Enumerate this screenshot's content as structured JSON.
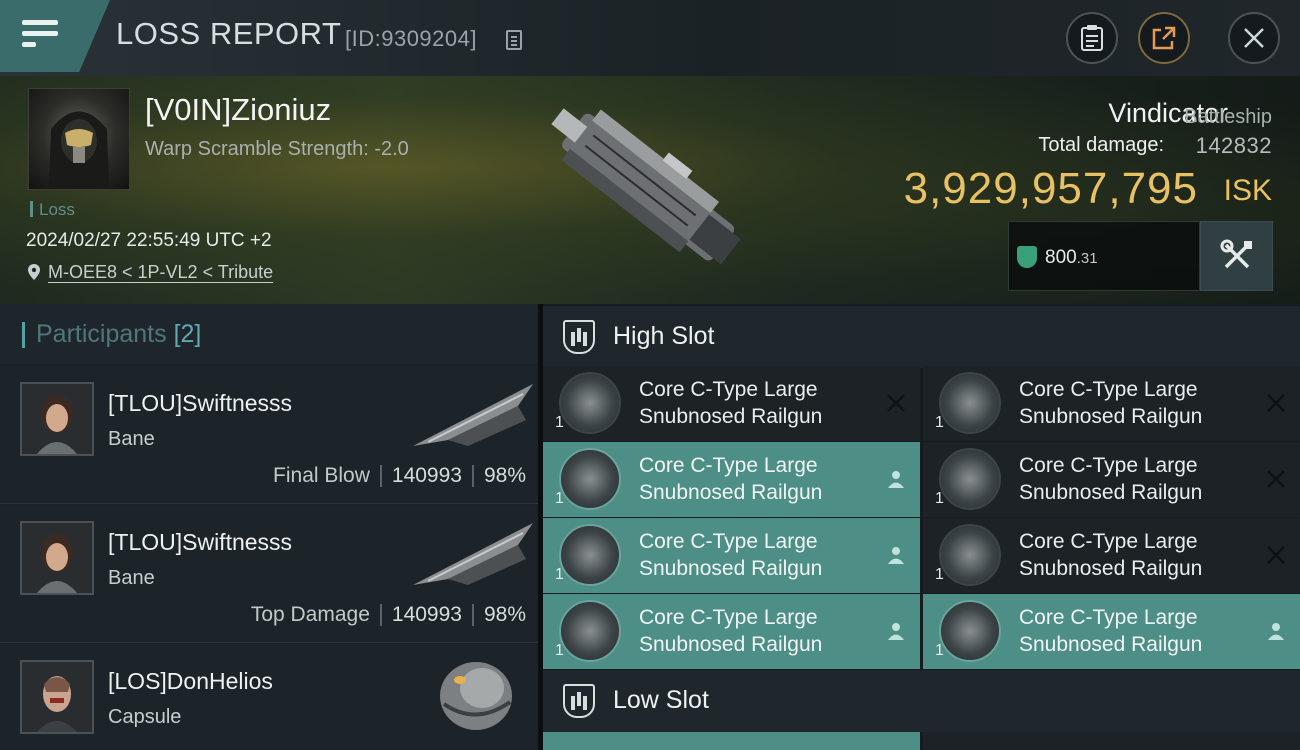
{
  "header": {
    "title": "LOSS REPORT",
    "report_id": "[ID:9309204]"
  },
  "victim": {
    "name": "[V0IN]Zioniuz",
    "warp_scramble": "Warp Scramble Strength: -2.0",
    "status": "Loss",
    "datetime": "2024/02/27 22:55:49 UTC +2",
    "location": "M-OEE8 < 1P-VL2 < Tribute",
    "ship_name": "Vindicator",
    "ship_class": "Battleship",
    "total_damage_label": "Total damage:",
    "total_damage": "142832",
    "isk_value": "3,929,957,795",
    "isk_unit": "ISK",
    "stat_value": "800",
    "stat_decimal": ".31"
  },
  "participants": {
    "label": "Participants",
    "count": "[2]",
    "items": [
      {
        "name": "[TLOU]Swiftnesss",
        "ship": "Bane",
        "tag": "Final Blow",
        "damage": "140993",
        "percent": "98%"
      },
      {
        "name": "[TLOU]Swiftnesss",
        "ship": "Bane",
        "tag": "Top Damage",
        "damage": "140993",
        "percent": "98%"
      },
      {
        "name": "[LOS]DonHelios",
        "ship": "Capsule",
        "tag": "",
        "damage": "",
        "percent": ""
      }
    ]
  },
  "slots": {
    "high_label": "High Slot",
    "low_label": "Low Slot",
    "module_line1": "Core C-Type Large",
    "module_line2": "Snubnosed Railgun",
    "qty": "1"
  },
  "colors": {
    "accent": "#4fa3a6",
    "isk": "#e8c165",
    "active_module": "#4d8e86"
  }
}
